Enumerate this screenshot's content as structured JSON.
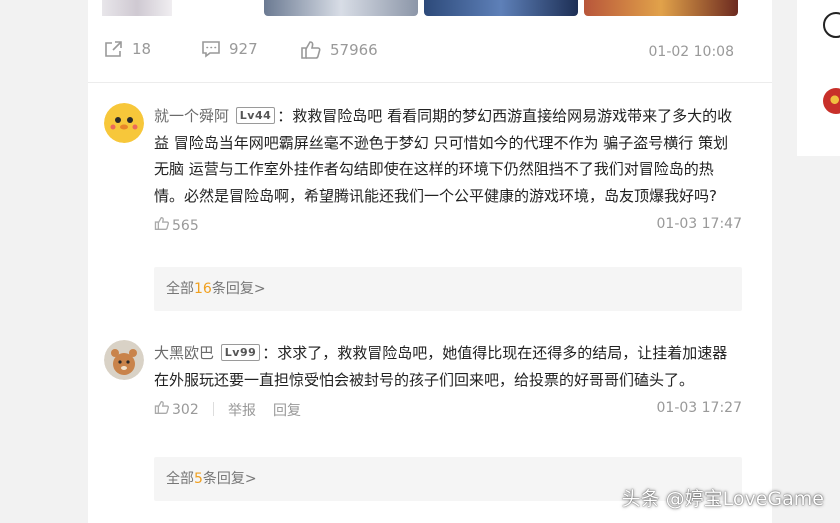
{
  "post": {
    "share_count": "18",
    "comment_count": "927",
    "like_count": "57966",
    "time": "01-02 10:08"
  },
  "comments": [
    {
      "username": "就一个舜阿",
      "level": "Lv44",
      "text": "：救救冒险岛吧 看看同期的梦幻西游直接给网易游戏带来了多大的收益 冒险岛当年网吧霸屏丝毫不逊色于梦幻 只可惜如今的代理不作为 骗子盗号横行 策划无脑 运营与工作室外挂作者勾结即使在这样的环境下仍然阻挡不了我们对冒险岛的热情。必然是冒险岛啊，希望腾讯能还我们一个公平健康的游戏环境，岛友顶爆我好吗?",
      "likes": "565",
      "time": "01-03 17:47",
      "replies_prefix": "全部",
      "replies_count": "16",
      "replies_suffix": "条回复>"
    },
    {
      "username": "大黑欧巴",
      "level": "Lv99",
      "text": "：求求了，救救冒险岛吧，她值得比现在还得多的结局，让挂着加速器在外服玩还要一直担惊受怕会被封号的孩子们回来吧，给投票的好哥哥们磕头了。",
      "likes": "302",
      "report_label": "举报",
      "reply_label": "回复",
      "time": "01-03 17:27",
      "replies_prefix": "全部",
      "replies_count": "5",
      "replies_suffix": "条回复>"
    }
  ],
  "watermark": "头条 @婷宝LoveGame"
}
